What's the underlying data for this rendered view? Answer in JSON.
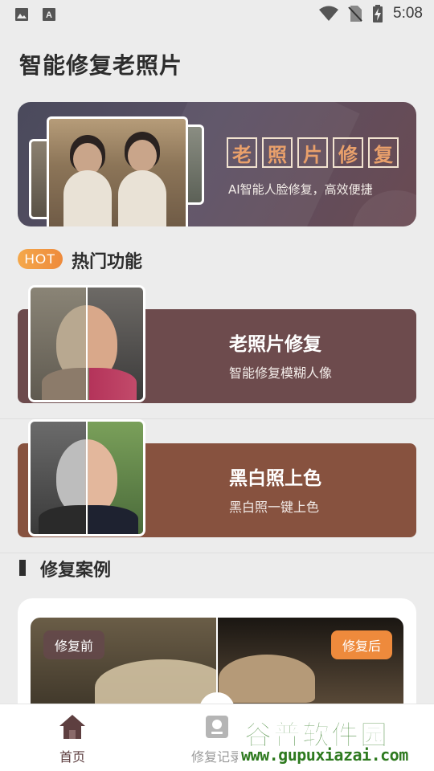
{
  "status_bar": {
    "time": "5:08",
    "left_icons": [
      "image-icon",
      "text-a-icon"
    ],
    "right_icons": [
      "wifi-icon",
      "no-sim-icon",
      "battery-charging-icon"
    ]
  },
  "page": {
    "title": "智能修复老照片"
  },
  "banner": {
    "title_chars": [
      "老",
      "照",
      "片",
      "修",
      "复"
    ],
    "subtitle": "AI智能人脸修复，高效便捷"
  },
  "hot_section": {
    "badge": "HOT",
    "title": "热门功能"
  },
  "features": [
    {
      "title": "老照片修复",
      "subtitle": "智能修复模糊人像",
      "color": "#6d4b4d"
    },
    {
      "title": "黑白照上色",
      "subtitle": "黑白照一键上色",
      "color": "#87523f"
    }
  ],
  "cases": {
    "title": "修复案例",
    "before_label": "修复前",
    "after_label": "修复后"
  },
  "bottom_nav": {
    "items": [
      {
        "label": "首页",
        "icon": "home-icon",
        "active": true
      },
      {
        "label": "修复记录",
        "icon": "records-icon",
        "active": false
      }
    ]
  },
  "watermark": {
    "top": "谷普软件园",
    "bottom": "www.gupuxiazai.com"
  },
  "colors": {
    "accent_orange": "#ee8a3c",
    "card_brown": "#6d4b4d",
    "card_rust": "#87523f",
    "nav_active": "#5e3f40"
  }
}
